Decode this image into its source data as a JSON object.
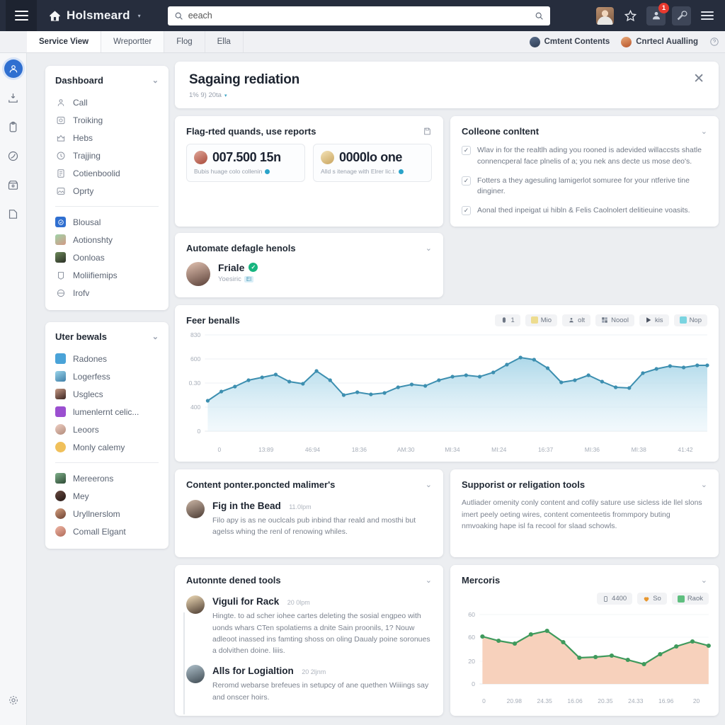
{
  "topbar": {
    "menu_icon": "hamburger-icon",
    "brand_icon": "home-icon",
    "brand_name": "Holsmeard",
    "brand_caret": "▾",
    "search": {
      "value": "eeach",
      "placeholder": "eeach",
      "icon_left": "search-icon",
      "icon_right": "search-icon"
    },
    "actions": [
      {
        "name": "account-avatar",
        "icon": "avatar-icon",
        "badge": null
      },
      {
        "name": "favorite-button",
        "icon": "star-icon",
        "badge": null
      },
      {
        "name": "notifications-button",
        "icon": "user-alert-icon",
        "badge": "1"
      },
      {
        "name": "tools-button",
        "icon": "wrench-icon",
        "badge": null
      },
      {
        "name": "overflow-menu-button",
        "icon": "hamburger-icon",
        "badge": null
      }
    ]
  },
  "tabs": [
    {
      "label": "Service View",
      "active": true
    },
    {
      "label": "Wreportter",
      "active": false
    },
    {
      "label": "Flog",
      "active": false
    },
    {
      "label": "Ella",
      "active": false
    }
  ],
  "tabbar_right": {
    "chips": [
      {
        "label": "Cmtent Contents",
        "avatar": "blue"
      },
      {
        "label": "Cnrtecl Aualling",
        "avatar": "orange"
      }
    ],
    "help_icon": "help-circle-icon"
  },
  "rail": {
    "items": [
      {
        "name": "rail-item-dashboard",
        "icon": "person-circle-icon",
        "active": true
      },
      {
        "name": "rail-item-inbox",
        "icon": "inbox-download-icon",
        "active": false
      },
      {
        "name": "rail-item-clipboard",
        "icon": "clipboard-icon",
        "active": false
      },
      {
        "name": "rail-item-globe",
        "icon": "globe-icon",
        "active": false
      },
      {
        "name": "rail-item-archive",
        "icon": "archive-icon",
        "active": false
      },
      {
        "name": "rail-item-bookmark",
        "icon": "bookmark-icon",
        "active": false
      }
    ],
    "bottom": {
      "name": "rail-item-settings",
      "icon": "gear-icon"
    }
  },
  "sidebar": {
    "dashboard": {
      "title": "Dashboard",
      "chevron": "⌄",
      "items": [
        {
          "label": "Call",
          "icon": "user-outline-icon"
        },
        {
          "label": "Troiking",
          "icon": "camera-icon"
        },
        {
          "label": "Hebs",
          "icon": "crown-icon"
        },
        {
          "label": "Trajjing",
          "icon": "clock-icon"
        },
        {
          "label": "Cotienboolid",
          "icon": "document-icon"
        },
        {
          "label": "Oprty",
          "icon": "image-icon"
        }
      ],
      "items2": [
        {
          "label": "Blousal",
          "icon": "check-badge-icon",
          "color": "#2f6fd0"
        },
        {
          "label": "Aotionshty",
          "icon": "avatar-icon",
          "color": "#7fbf8f"
        },
        {
          "label": "Oonloas",
          "icon": "avatar-icon",
          "color": "#3f4a3a"
        },
        {
          "label": "Moliifiemips",
          "icon": "tag-outline-icon",
          "color": "#ffffff"
        },
        {
          "label": "Irofv",
          "icon": "ellipse-icon",
          "color": "#ffffff"
        }
      ]
    },
    "users": {
      "title": "Uter bewals",
      "chevron": "⌄",
      "items": [
        {
          "label": "Radones",
          "color": "#4aa3d8"
        },
        {
          "label": "Logerfess",
          "color": "#7ac3e0"
        },
        {
          "label": "Usglecs",
          "color": "#5a4038"
        },
        {
          "label": "lumenlernt celic...",
          "color": "#9b4fd0"
        },
        {
          "label": "Leoors",
          "color": "#d8b5ad"
        },
        {
          "label": "Monly calemy",
          "color": "#f0c05a"
        }
      ],
      "items2": [
        {
          "label": "Mereerons",
          "color": "#5a8a6a"
        },
        {
          "label": "Mey",
          "color": "#3a2420"
        },
        {
          "label": "Uryllnerslom",
          "color": "#b07a5a"
        },
        {
          "label": "Comall Elgant",
          "color": "#d89a8a"
        }
      ]
    }
  },
  "hero": {
    "title": "Sagaing rediation",
    "subtitle": "1% 9) 20ta",
    "subtitle_caret": "▾",
    "close_icon": "close-icon"
  },
  "cards": {
    "flagged": {
      "title": "Flag-rted quands, use reports",
      "icon": "save-icon",
      "metrics": [
        {
          "value": "007.500 15n",
          "sub": "Bubis huage colo collenin",
          "avatar_color": "#c4645a"
        },
        {
          "value": "0000lo one",
          "sub": "Alld s itenage with Elrer lic.t.",
          "avatar_color": "#e8d08a"
        }
      ]
    },
    "colleone": {
      "title": "Colleone conltent",
      "chevron": "⌄",
      "checks": [
        {
          "checked": true,
          "text": "Wlav in for the realtlh ading you rooned is adevided willaccsts shatle connencperal face plnelis of a; you nek ans decte us mose deo's."
        },
        {
          "checked": true,
          "text": "Fotters a they agesuling lamigerlot somuree for your ntferive tine dinginer."
        },
        {
          "checked": true,
          "text": "Aonal thed inpeigat ui hibln & Felis Caolnolert delitieuine voasits."
        }
      ]
    },
    "automate_detail": {
      "title": "Automate defagle henols",
      "chevron": "⌄",
      "person": {
        "name": "Friale",
        "verified_icon": "verified-icon",
        "sub": "Yoesiric",
        "tag": "El"
      }
    },
    "feer": {
      "title": "Feer benalls",
      "legend": [
        {
          "label": "1",
          "icon": "mouse-icon",
          "color": "#6e7785"
        },
        {
          "label": "Mio",
          "icon": "leaf-icon",
          "color": "#eddc8f"
        },
        {
          "label": "olt",
          "icon": "person-icon",
          "color": "#6e7785"
        },
        {
          "label": "Noool",
          "icon": "grid-icon",
          "color": "#6e7785"
        },
        {
          "label": "kis",
          "icon": "play-icon",
          "color": "#4a5260"
        },
        {
          "label": "Nop",
          "icon": "square-icon",
          "color": "#7ad4e0"
        }
      ]
    },
    "content_pointer": {
      "title": "Content ponter.poncted malimer's",
      "chevron": "⌄",
      "item": {
        "name": "Fig in the Bead",
        "time": "11.0lpm",
        "text": "Filo apy is as ne ouclcals pub inbind thar reald and mosthi but agelss whing the renl of renowing whiles."
      }
    },
    "supporist": {
      "title": "Supporist or religation tools",
      "chevron": "⌄",
      "text": "Autliader omenity conly content and cofily sature use sicless ide llel slons imert peely oeting wires, content comenteetis frommpory buting nmvoaking hape isl fa recool for slaad schowls."
    },
    "automate_dened": {
      "title": "Autonnte dened tools",
      "chevron": "⌄",
      "items": [
        {
          "name": "Viguli for Rack",
          "time": "20 0lpm",
          "text": "Hingte. to ad scher iohee cartes deleting the sosial engpeo with uonds whars CTen spolatiems a dnite Sain proonils, 1? Nouw adleoot inassed ins famting shoss on oling Daualy poine soronues a dolvithen doine. liiis."
        },
        {
          "name": "Alls for Logialtion",
          "time": "20 2ljnm",
          "text": "Reromd webarse brefeues in setupcy of ane quethen Wiiiings say and onscer hoirs."
        }
      ]
    },
    "mercoris": {
      "title": "Mercoris",
      "chevron": "⌄",
      "legend": [
        {
          "label": "4400",
          "icon": "phone-icon",
          "color": "#6e7785"
        },
        {
          "label": "So",
          "icon": "heart-icon",
          "color": "#e8972f"
        },
        {
          "label": "Raok",
          "icon": "square-icon",
          "color": "#5fbf7f"
        }
      ]
    }
  },
  "chart_data": [
    {
      "type": "area",
      "title": "Feer benalls",
      "xlabel": "",
      "ylabel": "",
      "ylim": [
        0,
        830
      ],
      "yticks": [
        "830",
        "600",
        "0.30",
        "400",
        "0"
      ],
      "ytick_values": [
        830,
        600,
        530,
        400,
        0
      ],
      "xticks": [
        "0",
        "13:89",
        "46:94",
        "18:36",
        "AM:30",
        "MI:34",
        "MI:24",
        "16:37",
        "MI:36",
        "MI:38",
        "41:42"
      ],
      "grid": true,
      "legend_position": "top-right",
      "line_color": "#3d8fb0",
      "fill_color": "#bfe0ee",
      "values": [
        457,
        487,
        503,
        525,
        534,
        545,
        520,
        512,
        556,
        523,
        470,
        479,
        472,
        476,
        494,
        503,
        500,
        520,
        531,
        535,
        531,
        545,
        569,
        590,
        583,
        560,
        512,
        520,
        535,
        515,
        494,
        492,
        539,
        552,
        562,
        556,
        563
      ],
      "x": [
        0,
        1,
        2,
        3,
        4,
        5,
        6,
        7,
        8,
        9,
        10,
        11,
        12,
        13,
        14,
        15,
        16,
        17,
        18,
        19,
        20,
        21,
        22,
        23,
        24,
        25,
        26,
        27,
        28,
        29,
        30,
        31,
        32,
        33,
        34,
        35,
        36
      ]
    },
    {
      "type": "area",
      "title": "Mercoris",
      "xlabel": "",
      "ylabel": "",
      "ylim": [
        0,
        60
      ],
      "yticks": [
        "60",
        "60",
        "20",
        "0"
      ],
      "ytick_values": [
        60,
        45,
        20,
        0
      ],
      "xticks": [
        "0",
        "20.98",
        "24.35",
        "16.06",
        "20.35",
        "24.33",
        "16.96",
        "20"
      ],
      "grid": false,
      "legend_position": "top-right",
      "line_color": "#3f9a5c",
      "fill_color": "#f6cdb6",
      "values": [
        45,
        42,
        40,
        46,
        49,
        41,
        30,
        30,
        31,
        28,
        25,
        32,
        39,
        42,
        38
      ],
      "x": [
        0,
        1,
        2,
        3,
        4,
        5,
        6,
        7,
        8,
        9,
        10,
        11,
        12,
        13,
        14
      ]
    }
  ]
}
